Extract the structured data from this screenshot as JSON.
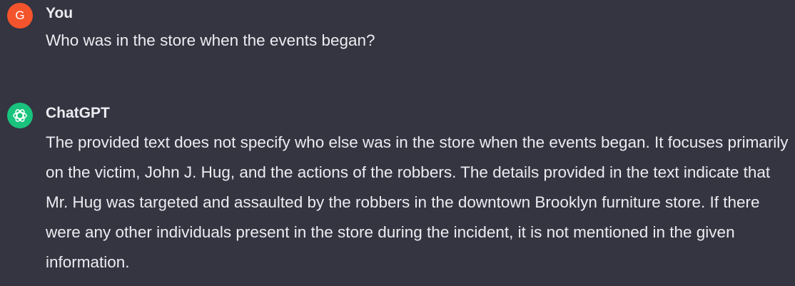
{
  "conversation": {
    "user_message": {
      "avatar_initial": "G",
      "author": "You",
      "text": "Who was in the store when the events began?"
    },
    "assistant_message": {
      "avatar_icon": "openai-logo-icon",
      "author": "ChatGPT",
      "text": "The provided text does not specify who else was in the store when the events began. It focuses primarily on the victim, John J. Hug, and the actions of the robbers. The details provided in the text indicate that Mr. Hug was targeted and assaulted by the robbers in the downtown Brooklyn furniture store. If there were any other individuals present in the store during the incident, it is not mentioned in the given information."
    }
  },
  "colors": {
    "background": "#343541",
    "text": "#ececf1",
    "user_avatar": "#f4542b",
    "assistant_avatar": "#19c37d"
  }
}
